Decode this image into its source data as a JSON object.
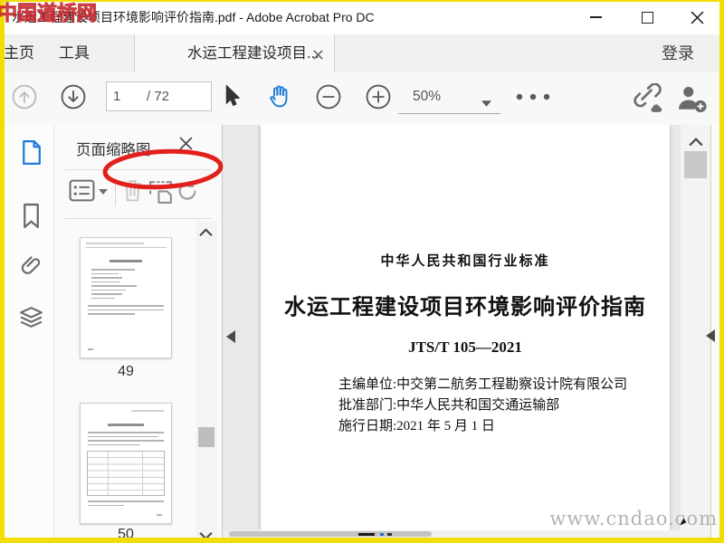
{
  "window": {
    "title": "水运工程建设项目环境影响评价指南.pdf - Adobe Acrobat Pro DC"
  },
  "watermarks": {
    "top_left": "中国道桥网",
    "bottom_right": "www.cndao.com"
  },
  "tabs": {
    "home": "主页",
    "tools": "工具",
    "doc": "水运工程建设项目...",
    "sign_in": "登录",
    "help_glyph": "?"
  },
  "toolbar": {
    "page_current": "1",
    "page_total": "/ 72",
    "zoom_level": "50%"
  },
  "panel": {
    "title": "页面缩略图",
    "pages": [
      {
        "label": "49"
      },
      {
        "label": "50"
      }
    ]
  },
  "document": {
    "standard_type": "中华人民共和国行业标准",
    "title": "水运工程建设项目环境影响评价指南",
    "code": "JTS/T 105—2021",
    "info_lines": [
      "主编单位:中交第二航务工程勘察设计院有限公司",
      "批准部门:中华人民共和国交通运输部",
      "施行日期:2021 年 5 月 1 日"
    ]
  },
  "colors": {
    "frame_yellow": "#F2DE02",
    "acrobat_blue": "#1E7BD9",
    "annotation_red": "#E2201B"
  }
}
